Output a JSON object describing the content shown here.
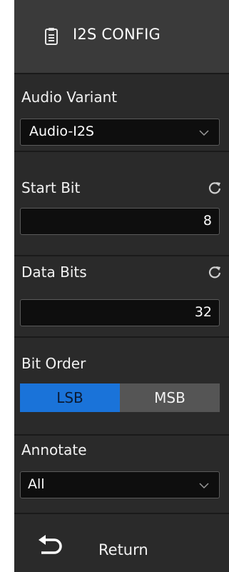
{
  "panel": {
    "title": "I2S CONFIG",
    "title_icon": "clipboard-icon"
  },
  "audio_variant": {
    "label": "Audio Variant",
    "value": "Audio-I2S"
  },
  "start_bit": {
    "label": "Start Bit",
    "value": "8"
  },
  "data_bits": {
    "label": "Data Bits",
    "value": "32"
  },
  "bit_order": {
    "label": "Bit Order",
    "options": [
      "LSB",
      "MSB"
    ],
    "selected": "LSB"
  },
  "annotate": {
    "label": "Annotate",
    "value": "All"
  },
  "footer": {
    "return_label": "Return"
  },
  "colors": {
    "panel_bg": "#2a2a2a",
    "active_toggle": "#1a73d9",
    "inactive_toggle": "#555555"
  }
}
